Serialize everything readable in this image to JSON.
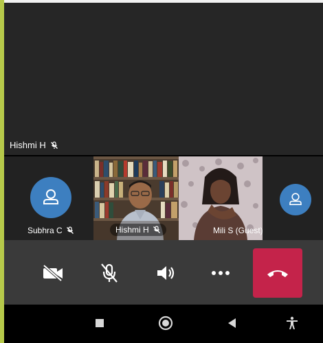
{
  "main_speaker": {
    "name": "Hishmi H",
    "muted": true
  },
  "participants": [
    {
      "name": "Subhra C",
      "type": "avatar",
      "muted": true
    },
    {
      "name": "Hishmi H",
      "type": "video",
      "muted": true
    },
    {
      "name": "Mili S (Guest)",
      "type": "video",
      "muted": false
    },
    {
      "name": "",
      "type": "avatar",
      "muted": false
    }
  ],
  "controls": [
    {
      "id": "camera",
      "icon": "camera-off-icon"
    },
    {
      "id": "mic",
      "icon": "mic-off-icon"
    },
    {
      "id": "speaker",
      "icon": "speaker-icon"
    },
    {
      "id": "more",
      "icon": "more-icon"
    },
    {
      "id": "end-call",
      "icon": "hang-up-icon"
    }
  ],
  "colors": {
    "end_call": "#c4234a",
    "avatar": "#3d7fc0",
    "accent_edge": "#b6c94a"
  },
  "nav": [
    "recents-icon",
    "home-icon",
    "back-icon",
    "accessibility-icon"
  ]
}
